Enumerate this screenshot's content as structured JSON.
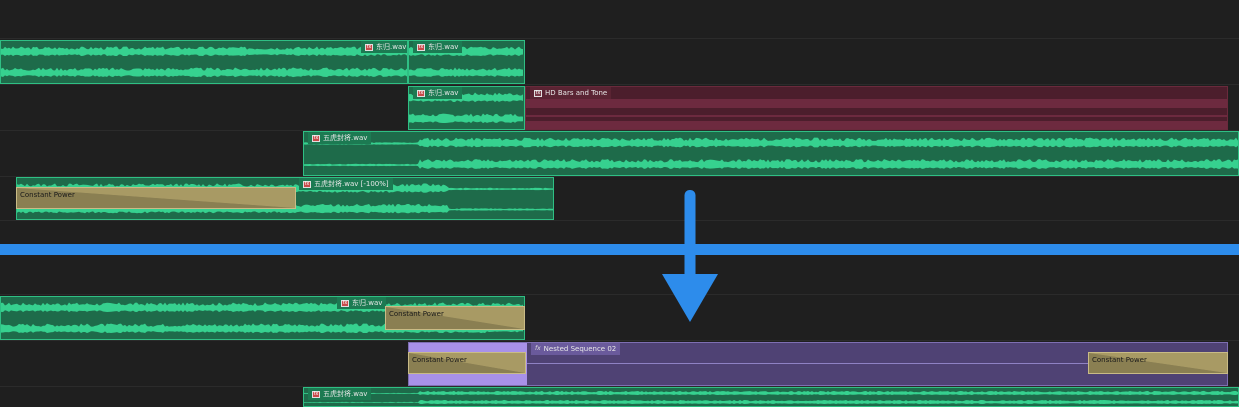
{
  "top": {
    "clips": {
      "v1_left_label": "东归.wav",
      "v1_right_label": "东归.wav",
      "v2_label": "东归.wav",
      "hd_bars_label": "HD Bars and Tone",
      "wuhu_label": "五虎封将.wav",
      "wuhu_reverse_label": "五虎封将.wav [-100%]",
      "constant_power_label": "Constant Power"
    }
  },
  "bottom": {
    "clips": {
      "v1_label": "东归.wav",
      "constant_power_1": "Constant Power",
      "constant_power_2": "Constant Power",
      "nested_label": "Nested Sequence 02",
      "constant_power_3": "Constant Power",
      "wuhu_label": "五虎封将.wav"
    }
  },
  "icons": {
    "fx": "fx",
    "arrow": "down-arrow-icon"
  },
  "colors": {
    "background": "#1f1f1f",
    "audio_clip": "#1e6b4a",
    "waveform": "#36d18f",
    "divider": "#2d8ceb",
    "hd_bars": "#4c1e2c",
    "nested": "#4f4274",
    "transition": "#a89a64"
  }
}
